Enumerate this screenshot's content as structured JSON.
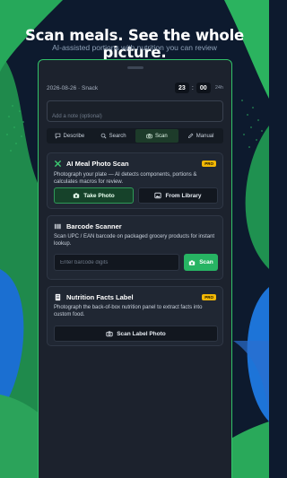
{
  "promo": {
    "headline": "Scan meals. See the whole picture.",
    "subheadline": "AI-assisted portions with nutrition you can review"
  },
  "entry": {
    "date_meal": "2026-08-26 · Snack",
    "time_hour": "23",
    "time_minute": "00",
    "time_format": "24h",
    "note_placeholder": "Add a note (optional)"
  },
  "tabs": [
    {
      "label": "Describe",
      "icon": "speech-bubble-icon",
      "active": false
    },
    {
      "label": "Search",
      "icon": "search-icon",
      "active": false
    },
    {
      "label": "Scan",
      "icon": "camera-icon",
      "active": true
    },
    {
      "label": "Manual",
      "icon": "pencil-icon",
      "active": false
    }
  ],
  "photo_scan": {
    "title": "AI Meal Photo Scan",
    "badge": "PRO",
    "description": "Photograph your plate — AI detects components, portions & calculates macros for review.",
    "take_photo": "Take Photo",
    "from_library": "From Library"
  },
  "barcode": {
    "title": "Barcode Scanner",
    "description": "Scan UPC / EAN barcode on packaged grocery products for instant lookup.",
    "input_placeholder": "Enter barcode digits",
    "scan_button": "Scan"
  },
  "nutrition_label": {
    "title": "Nutrition Facts Label",
    "badge": "PRO",
    "description": "Photograph the back-of-box nutrition panel to extract facts into custom food.",
    "scan_button": "Scan Label Photo"
  },
  "colors": {
    "accent_green": "#27b463",
    "pro_badge": "#f2b705",
    "background_navy": "#0d1a2e",
    "panel": "#1c222d"
  }
}
